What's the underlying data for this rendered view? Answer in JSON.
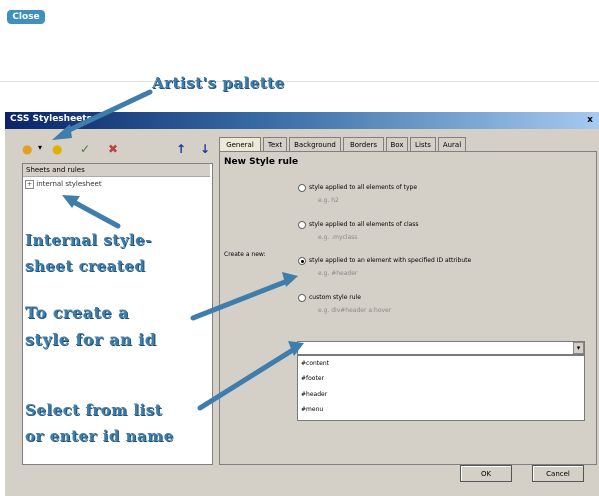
{
  "close_button": "Close",
  "callouts": {
    "palette": "Artist's palette",
    "internal_1": "Internal style-",
    "internal_2": "sheet created",
    "create_1": "To create a",
    "create_2": "style for an id",
    "select_1": "Select from list",
    "select_2": "or enter id name"
  },
  "window": {
    "title": "CSS Stylesheets",
    "close": "x"
  },
  "sheets": {
    "header": "Sheets and rules",
    "item": "internal stylesheet"
  },
  "tabs": [
    "General",
    "Text",
    "Background",
    "Borders",
    "Box",
    "Lists",
    "Aural"
  ],
  "panel": {
    "title": "New Style rule",
    "create_label": "Create a new:",
    "options": [
      {
        "label": "style applied to all elements of type",
        "eg": "e.g. h2"
      },
      {
        "label": "style applied to all elements of class",
        "eg": "e.g. .myclass"
      },
      {
        "label": "style applied to an element with specified ID attribute",
        "eg": "e.g. #header"
      },
      {
        "label": "custom style rule",
        "eg": "e.g. div#header a:hover"
      }
    ],
    "combo_value": "",
    "dropdown": [
      "#content",
      "#footer",
      "#header",
      "#menu"
    ]
  },
  "buttons": {
    "ok": "OK",
    "cancel": "Cancel"
  },
  "colors": {
    "callout": "#3f7dad",
    "arrow": "#3f7dad",
    "titlebar": "#0a246a"
  }
}
